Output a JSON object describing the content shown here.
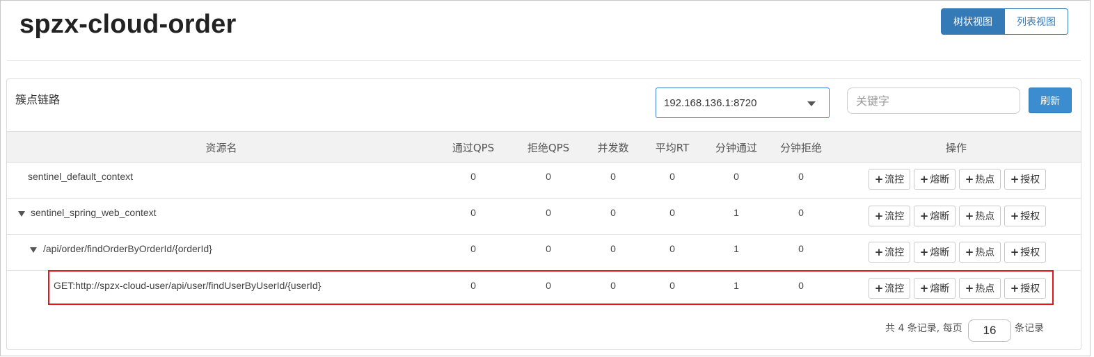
{
  "app": {
    "title": "spzx-cloud-order"
  },
  "view_toggle": {
    "tree_label": "树状视图",
    "list_label": "列表视图"
  },
  "panel": {
    "title": "簇点链路",
    "machine": "192.168.136.1:8720",
    "search_placeholder": "关键字",
    "refresh_label": "刷新"
  },
  "table": {
    "headers": [
      "资源名",
      "通过QPS",
      "拒绝QPS",
      "并发数",
      "平均RT",
      "分钟通过",
      "分钟拒绝",
      "操作"
    ],
    "rows": [
      {
        "name": "sentinel_default_context",
        "pass_qps": "0",
        "block_qps": "0",
        "concurrency": "0",
        "avg_rt": "0",
        "minute_pass": "0",
        "minute_block": "0",
        "expanded": false
      },
      {
        "name": "sentinel_spring_web_context",
        "pass_qps": "0",
        "block_qps": "0",
        "concurrency": "0",
        "avg_rt": "0",
        "minute_pass": "1",
        "minute_block": "0",
        "expanded": true
      },
      {
        "name": "/api/order/findOrderByOrderId/{orderId}",
        "pass_qps": "0",
        "block_qps": "0",
        "concurrency": "0",
        "avg_rt": "0",
        "minute_pass": "1",
        "minute_block": "0",
        "expanded": true
      },
      {
        "name": "GET:http://spzx-cloud-user/api/user/findUserByUserId/{userId}",
        "pass_qps": "0",
        "block_qps": "0",
        "concurrency": "0",
        "avg_rt": "0",
        "minute_pass": "1",
        "minute_block": "0",
        "expanded": false
      }
    ],
    "actions": {
      "plus": "+",
      "flow": "流控",
      "degrade": "熔断",
      "hotspot": "热点",
      "auth": "授权"
    }
  },
  "pager": {
    "total_prefix": "共 4 条记录, 每页",
    "page_size": "16",
    "suffix": "条记录"
  },
  "colors": {
    "primary": "#337ab7",
    "highlight": "#e0161b"
  }
}
